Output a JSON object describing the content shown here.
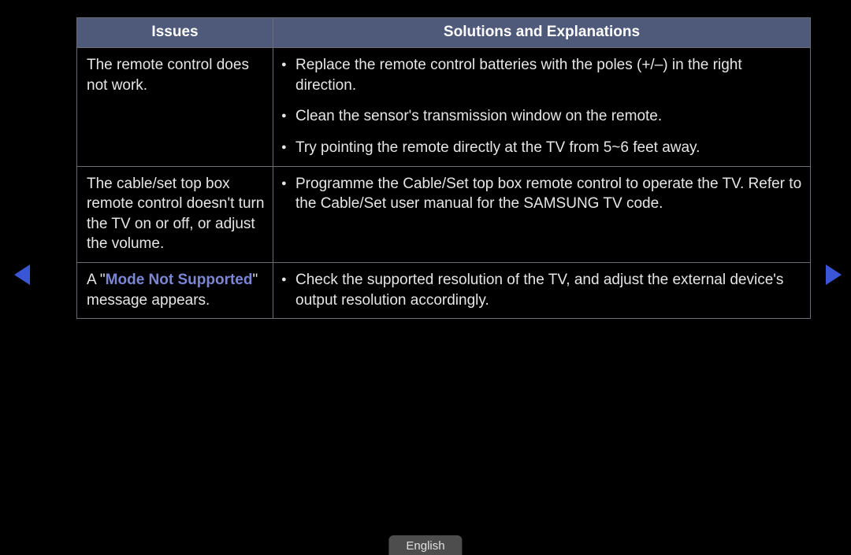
{
  "headers": {
    "issues": "Issues",
    "solutions": "Solutions and Explanations"
  },
  "rows": [
    {
      "issue_html": "The remote control does not work.",
      "solutions": [
        "Replace the remote control batteries with the poles (+/–) in the right direction.",
        "Clean the sensor's transmission window on the remote.",
        "Try pointing the remote directly at the TV from 5~6 feet away."
      ]
    },
    {
      "issue_html": "The cable/set top box remote control doesn't turn the TV on or off, or adjust the volume.",
      "solutions": [
        "Programme the Cable/Set top box remote control to operate the TV. Refer to the Cable/Set user manual for the SAMSUNG TV code."
      ]
    },
    {
      "issue_prefix": "A \"",
      "issue_highlight": "Mode Not Supported",
      "issue_suffix": "\" message appears.",
      "solutions": [
        "Check the supported resolution of the TV, and adjust the external device's output resolution accordingly."
      ]
    }
  ],
  "language": "English"
}
